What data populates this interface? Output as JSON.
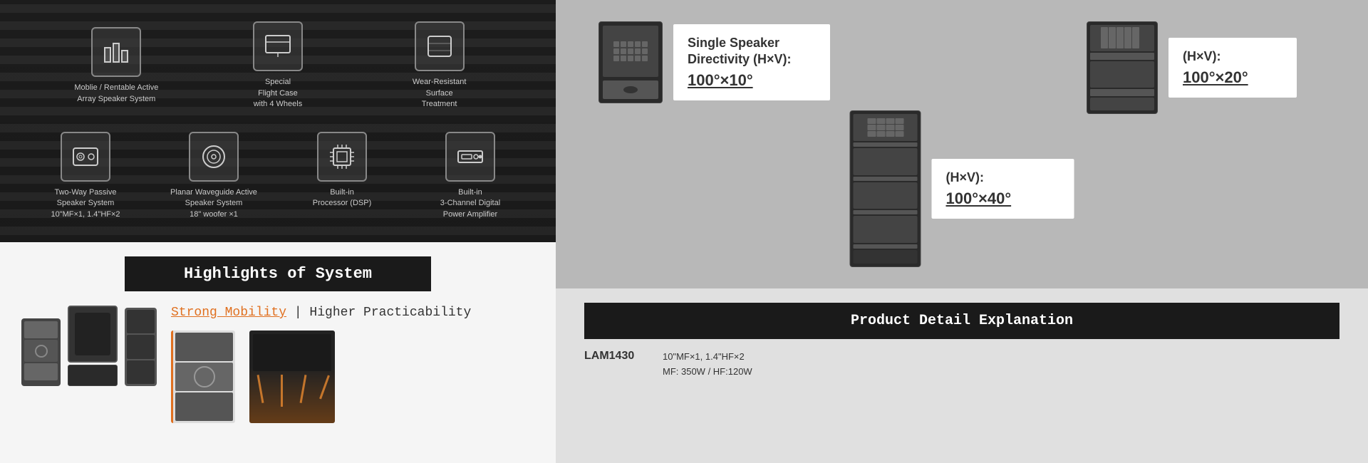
{
  "left_panel": {
    "icons_row1": [
      {
        "id": "mobile-rentable",
        "label": "Moblie / Rentable\nActive Array\nSpeaker System",
        "icon_type": "bar-chart"
      },
      {
        "id": "special-flight",
        "label": "Special\nFlight Case\nwith 4 Wheels",
        "icon_type": "screen"
      },
      {
        "id": "wear-resistant",
        "label": "Wear-Resistant\nSurface\nTreatment",
        "icon_type": "square"
      }
    ],
    "icons_row2": [
      {
        "id": "two-way-passive",
        "label": "Two-Way Passive\nSpeaker System\n10\"MF×1, 1.4\"HF×2",
        "icon_type": "speaker"
      },
      {
        "id": "planar-waveguide",
        "label": "Planar Waveguide Active\nSpeaker System\n18\" woofer ×1",
        "icon_type": "circle-target"
      },
      {
        "id": "built-in-processor",
        "label": "Built-in\nProcessor (DSP)",
        "icon_type": "processor"
      },
      {
        "id": "built-in-amplifier",
        "label": "Built-in\n3-Channel Digital\nPower Amplifier",
        "icon_type": "amplifier"
      }
    ],
    "highlights_title": "Highlights of System",
    "mobility_text_highlight": "Strong Mobility",
    "mobility_text_rest": " | Higher Practicability"
  },
  "right_panel": {
    "directivity_items": [
      {
        "id": "single-speaker",
        "title": "Single Speaker\nDirectivity (H×V):",
        "value": "100°×10°",
        "speaker_type": "single"
      },
      {
        "id": "double-speaker",
        "title": "(H×V):",
        "value": "100°×20°",
        "speaker_type": "double"
      },
      {
        "id": "quad-speaker",
        "title": "(H×V):",
        "value": "100°×40°",
        "speaker_type": "quad"
      }
    ],
    "product_detail_title": "Product Detail Explanation",
    "spec_model": "LAM1430",
    "spec_line1": "10\"MF×1, 1.4\"HF×2",
    "spec_line2": "MF: 350W / HF:120W"
  }
}
